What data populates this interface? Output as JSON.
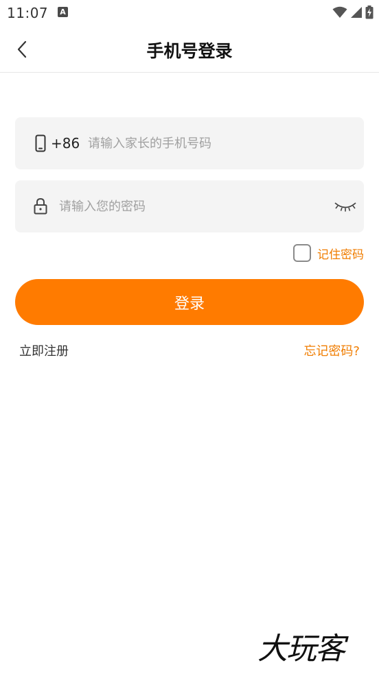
{
  "status_bar": {
    "time": "11:07",
    "notification_badge": "A"
  },
  "nav": {
    "title": "手机号登录"
  },
  "phone": {
    "country_code": "+86",
    "placeholder": "请输入家长的手机号码",
    "value": ""
  },
  "password": {
    "placeholder": "请输入您的密码",
    "value": ""
  },
  "remember": {
    "label": "记住密码",
    "checked": false
  },
  "login": {
    "label": "登录"
  },
  "links": {
    "register": "立即注册",
    "forgot": "忘记密码?"
  },
  "watermark": {
    "text": "大玩客"
  },
  "colors": {
    "accent": "#ff7b00",
    "accent_text": "#f07d00",
    "field_bg": "#f4f4f4"
  }
}
